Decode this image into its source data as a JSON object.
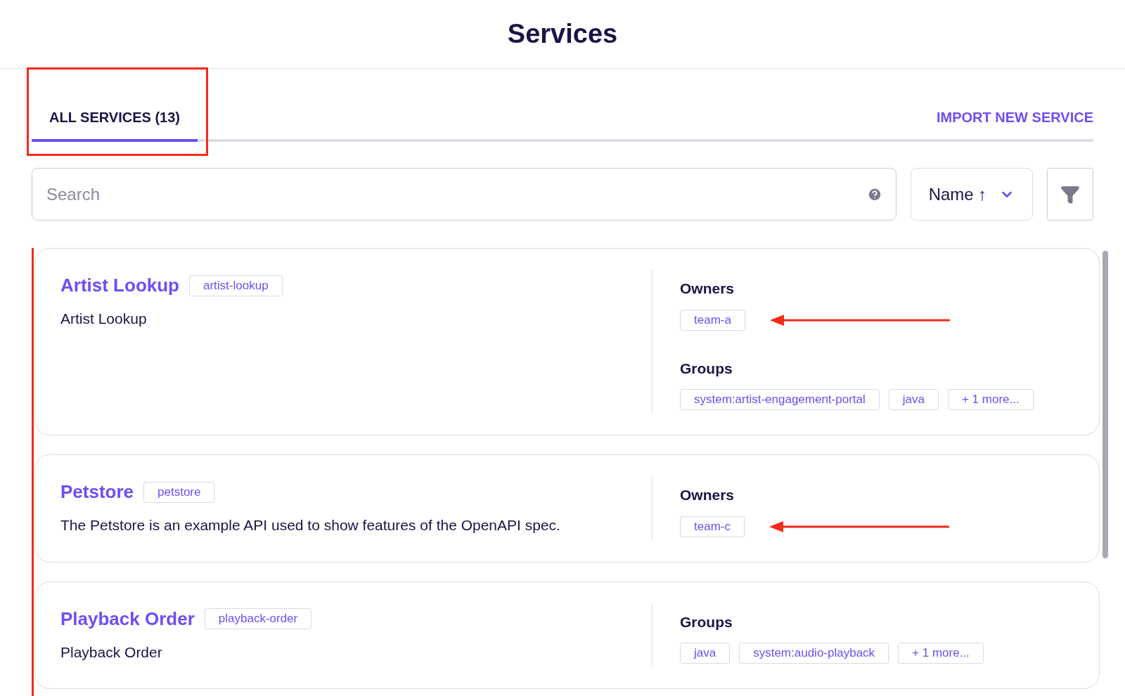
{
  "page": {
    "title": "Services"
  },
  "tabs": [
    {
      "label": "ALL SERVICES (13)",
      "selected": true,
      "highlighted": true
    }
  ],
  "import_link": "IMPORT NEW SERVICE",
  "search": {
    "placeholder": "Search"
  },
  "sort": {
    "label": "Name ↑"
  },
  "list": {
    "marked": true
  },
  "services": [
    {
      "name": "Artist Lookup",
      "slug": "artist-lookup",
      "description": "Artist Lookup",
      "sections": [
        {
          "heading": "Owners",
          "highlighted": true,
          "tags": [
            "team-a"
          ]
        },
        {
          "heading": "Groups",
          "tags": [
            "system:artist-engagement-portal",
            "java",
            "+ 1 more..."
          ]
        }
      ]
    },
    {
      "name": "Petstore",
      "slug": "petstore",
      "description": "The Petstore is an example API used to show features of the OpenAPI spec.",
      "sections": [
        {
          "heading": "Owners",
          "highlighted": true,
          "tags": [
            "team-c"
          ]
        }
      ]
    },
    {
      "name": "Playback Order",
      "slug": "playback-order",
      "description": "Playback Order",
      "sections": [
        {
          "heading": "Groups",
          "tags": [
            "java",
            "system:audio-playback",
            "+ 1 more..."
          ]
        }
      ]
    }
  ]
}
